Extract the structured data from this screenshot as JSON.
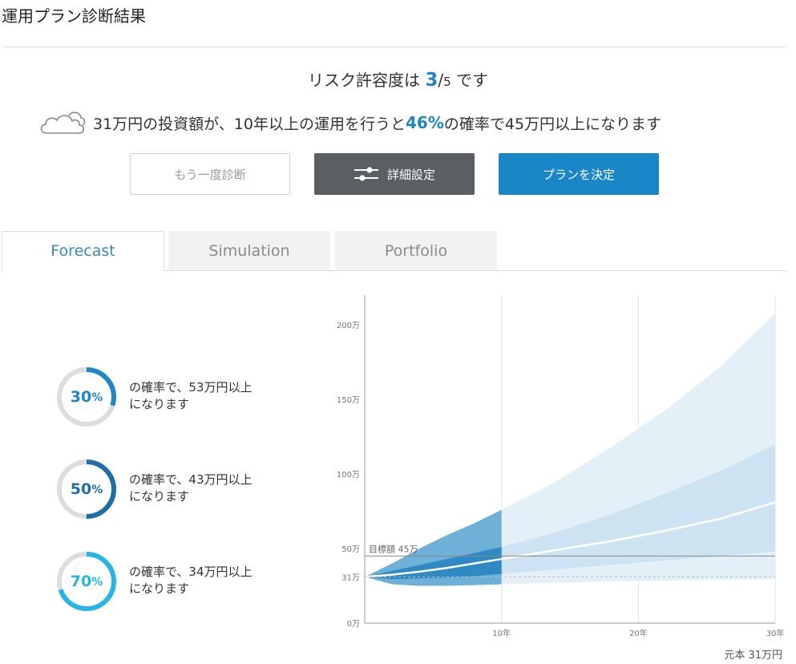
{
  "page": {
    "title": "運用プラン診断結果"
  },
  "risk": {
    "prefix": "リスク許容度は ",
    "value": "3",
    "slash": "/",
    "max": "5",
    "suffix": " です"
  },
  "summary": {
    "icon": "cloud-icon",
    "part1": "31万円の投資額が、10年以上の運用を行うと",
    "percent": "46%",
    "part2": "の確率で45万円以上になります"
  },
  "buttons": {
    "retry": "もう一度診断",
    "detail": "詳細設定",
    "detail_icon": "sliders-icon",
    "plan": "プランを決定"
  },
  "tabs": [
    {
      "label": "Forecast",
      "active": true
    },
    {
      "label": "Simulation",
      "active": false
    },
    {
      "label": "Portfolio",
      "active": false
    }
  ],
  "probabilities": [
    {
      "pct": "30",
      "unit": "%",
      "fraction": 0.3,
      "color": "#1e86c6",
      "line1": "の確率で、53万円以上",
      "line2": "になります"
    },
    {
      "pct": "50",
      "unit": "%",
      "fraction": 0.5,
      "color": "#1e6fa8",
      "line1": "の確率で、43万円以上",
      "line2": "になります"
    },
    {
      "pct": "70",
      "unit": "%",
      "fraction": 0.7,
      "color": "#27b5e6",
      "line1": "の確率で、34万円以上",
      "line2": "になります"
    }
  ],
  "chart_data": {
    "type": "area",
    "y_ticks": [
      {
        "value": 200,
        "label": "200万"
      },
      {
        "value": 150,
        "label": "150万"
      },
      {
        "value": 100,
        "label": "100万"
      },
      {
        "value": 50,
        "label": "50万"
      },
      {
        "value": 31,
        "label": "31万"
      },
      {
        "value": 0,
        "label": "0万"
      }
    ],
    "x_ticks": [
      {
        "value": 10,
        "label": "10年"
      },
      {
        "value": 20,
        "label": "20年"
      },
      {
        "value": 30,
        "label": "30年"
      }
    ],
    "xlim": [
      0,
      30
    ],
    "ylim": [
      0,
      220
    ],
    "target": {
      "value": 45,
      "label": "目標額 45万"
    },
    "principal": {
      "value": 31,
      "note": "元本 31万円"
    },
    "highlight_until_year": 10,
    "colors": {
      "outer": "#6fb0d8",
      "inner": "#2f8ac4",
      "outer_light": "#e4f0f8",
      "inner_light": "#cde3f2",
      "median": "#ffffff"
    },
    "years": [
      0,
      2,
      4,
      6,
      8,
      10,
      14,
      18,
      22,
      26,
      30
    ],
    "upper_outer": [
      31,
      40,
      50,
      59,
      67,
      76,
      95,
      118,
      143,
      172,
      208
    ],
    "upper_inner": [
      31,
      35,
      39,
      43,
      47,
      51,
      61,
      73,
      87,
      102,
      120
    ],
    "median": [
      31,
      32.5,
      34.5,
      37,
      40,
      43,
      49,
      55,
      62,
      70,
      81
    ],
    "lower_inner": [
      31,
      29.5,
      30,
      30.5,
      31.5,
      33,
      36,
      39,
      42,
      45,
      48
    ],
    "lower_outer": [
      31,
      26,
      25,
      25,
      25.5,
      26,
      27,
      28,
      28.5,
      29,
      29.5
    ]
  }
}
